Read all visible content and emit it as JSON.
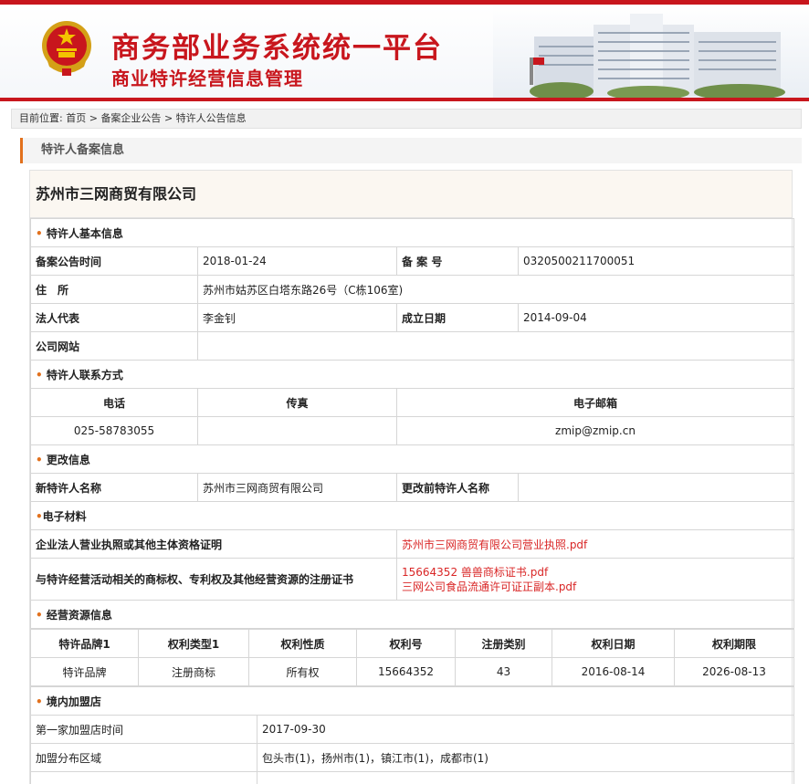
{
  "header": {
    "title_main": "商务部业务系统统一平台",
    "title_sub": "商业特许经营信息管理"
  },
  "breadcrumb": {
    "prefix": "目前位置:",
    "home": "首页",
    "sep": ">",
    "level2": "备案企业公告",
    "level3": "特许人公告信息"
  },
  "section_title": "特许人备案信息",
  "company_name": "苏州市三网商贸有限公司",
  "basic": {
    "title": "特许人基本信息",
    "announce_time_label": "备案公告时间",
    "announce_time": "2018-01-24",
    "record_no_label": "备 案 号",
    "record_no": "0320500211700051",
    "address_label": "住　所",
    "address": "苏州市姑苏区白塔东路26号（C栋106室)",
    "legal_rep_label": "法人代表",
    "legal_rep": "李金钊",
    "established_label": "成立日期",
    "established": "2014-09-04",
    "website_label": "公司网站",
    "website": ""
  },
  "contact": {
    "title": "特许人联系方式",
    "phone_label": "电话",
    "fax_label": "传真",
    "email_label": "电子邮箱",
    "phone": "025-58783055",
    "fax": "",
    "email": "zmip@zmip.cn"
  },
  "change": {
    "title": "更改信息",
    "new_name_label": "新特许人名称",
    "new_name": "苏州市三网商贸有限公司",
    "old_name_label": "更改前特许人名称",
    "old_name": ""
  },
  "materials": {
    "title": "电子材料",
    "license_label": "企业法人营业执照或其他主体资格证明",
    "license_file": "苏州市三网商贸有限公司营业执照.pdf",
    "rights_label": "与特许经营活动相关的商标权、专利权及其他经营资源的注册证书",
    "rights_file_1": "15664352 兽兽商标证书.pdf",
    "rights_file_2": "三网公司食品流通许可证正副本.pdf"
  },
  "resources": {
    "title": "经营资源信息",
    "columns": [
      "特许品牌1",
      "权利类型1",
      "权利性质",
      "权利号",
      "注册类别",
      "权利日期",
      "权利期限"
    ],
    "row": [
      "特许品牌",
      "注册商标",
      "所有权",
      "15664352",
      "43",
      "2016-08-14",
      "2026-08-13"
    ]
  },
  "stores": {
    "title": "境内加盟店",
    "first_store_time_label": "第一家加盟店时间",
    "first_store_time": "2017-09-30",
    "distribution_label": "加盟分布区域",
    "distribution": "包头市(1)，扬州市(1)，镇江市(1)，成都市(1)"
  },
  "colors": {
    "brand_red": "#c8161d",
    "accent_orange": "#e2711d",
    "link_red": "#d92626"
  }
}
